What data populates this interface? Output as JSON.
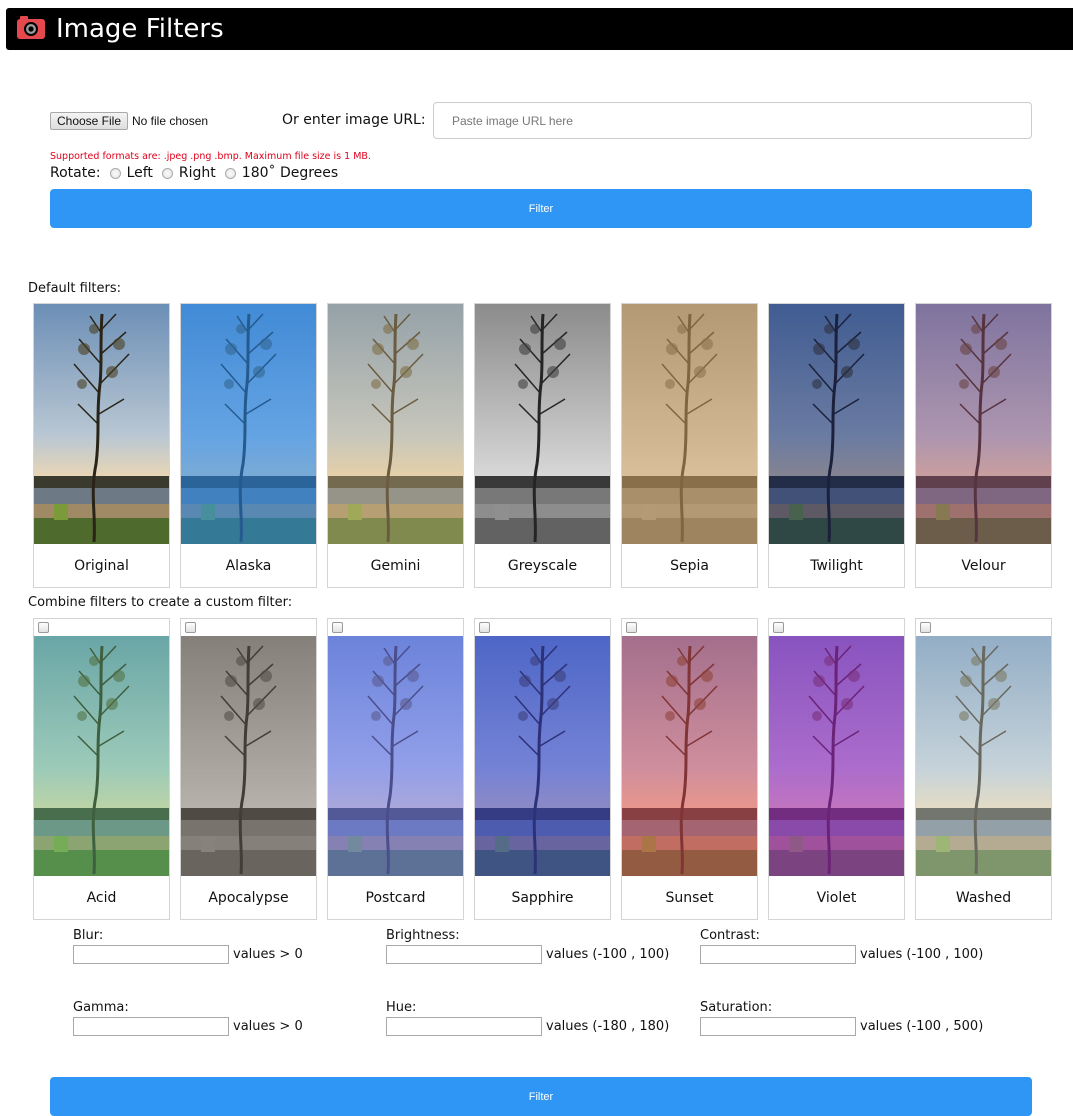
{
  "app": {
    "title": "Image Filters",
    "icon": "camera-icon"
  },
  "upload": {
    "choose_label": "Choose File",
    "no_file": "No file chosen",
    "url_label": "Or enter image URL:",
    "url_placeholder": "Paste image URL here",
    "url_value": "",
    "formats_note": "Supported formats are: .jpeg .png .bmp. Maximum file size is 1 MB."
  },
  "rotate": {
    "label": "Rotate:",
    "options": [
      "Left",
      "Right",
      "180˚ Degrees"
    ]
  },
  "filter_button": "Filter",
  "default_filters": {
    "label": "Default filters:",
    "items": [
      {
        "name": "Original",
        "tint": "#000000",
        "tint_opacity": 0.0,
        "grey": 0
      },
      {
        "name": "Alaska",
        "tint": "#1f86f0",
        "tint_opacity": 0.55,
        "grey": 0
      },
      {
        "name": "Gemini",
        "tint": "#e2c58e",
        "tint_opacity": 0.35,
        "grey": 0
      },
      {
        "name": "Greyscale",
        "tint": "#000000",
        "tint_opacity": 0.0,
        "grey": 1
      },
      {
        "name": "Sepia",
        "tint": "#d9a85c",
        "tint_opacity": 0.5,
        "grey": 1
      },
      {
        "name": "Twilight",
        "tint": "#0c1e66",
        "tint_opacity": 0.45,
        "grey": 0
      },
      {
        "name": "Velour",
        "tint": "#9b4b7a",
        "tint_opacity": 0.4,
        "grey": 0
      }
    ]
  },
  "combine_filters": {
    "label": "Combine filters to create a custom filter:",
    "items": [
      {
        "name": "Acid",
        "tint": "#66d08a",
        "tint_opacity": 0.35,
        "grey": 0,
        "checked": false
      },
      {
        "name": "Apocalypse",
        "tint": "#7a6a5a",
        "tint_opacity": 0.35,
        "grey": 1,
        "checked": false
      },
      {
        "name": "Postcard",
        "tint": "#6b78ff",
        "tint_opacity": 0.5,
        "grey": 0,
        "checked": false
      },
      {
        "name": "Sapphire",
        "tint": "#2f3ed8",
        "tint_opacity": 0.5,
        "grey": 0,
        "checked": false
      },
      {
        "name": "Sunset",
        "tint": "#e84a5c",
        "tint_opacity": 0.45,
        "grey": 0,
        "checked": false
      },
      {
        "name": "Violet",
        "tint": "#a023c7",
        "tint_opacity": 0.55,
        "grey": 0,
        "checked": false
      },
      {
        "name": "Washed",
        "tint": "#dce7e4",
        "tint_opacity": 0.35,
        "grey": 0,
        "checked": false
      }
    ]
  },
  "params": [
    {
      "label": "Blur:",
      "hint": "values > 0",
      "value": ""
    },
    {
      "label": "Brightness:",
      "hint": "values (-100 , 100)",
      "value": ""
    },
    {
      "label": "Contrast:",
      "hint": "values (-100 , 100)",
      "value": ""
    },
    {
      "label": "Gamma:",
      "hint": "values > 0",
      "value": ""
    },
    {
      "label": "Hue:",
      "hint": "values (-180 , 180)",
      "value": ""
    },
    {
      "label": "Saturation:",
      "hint": "values (-100 , 500)",
      "value": ""
    }
  ],
  "colors": {
    "accent": "#2f96f5",
    "header_bg": "#000000",
    "error": "#e0001a"
  }
}
